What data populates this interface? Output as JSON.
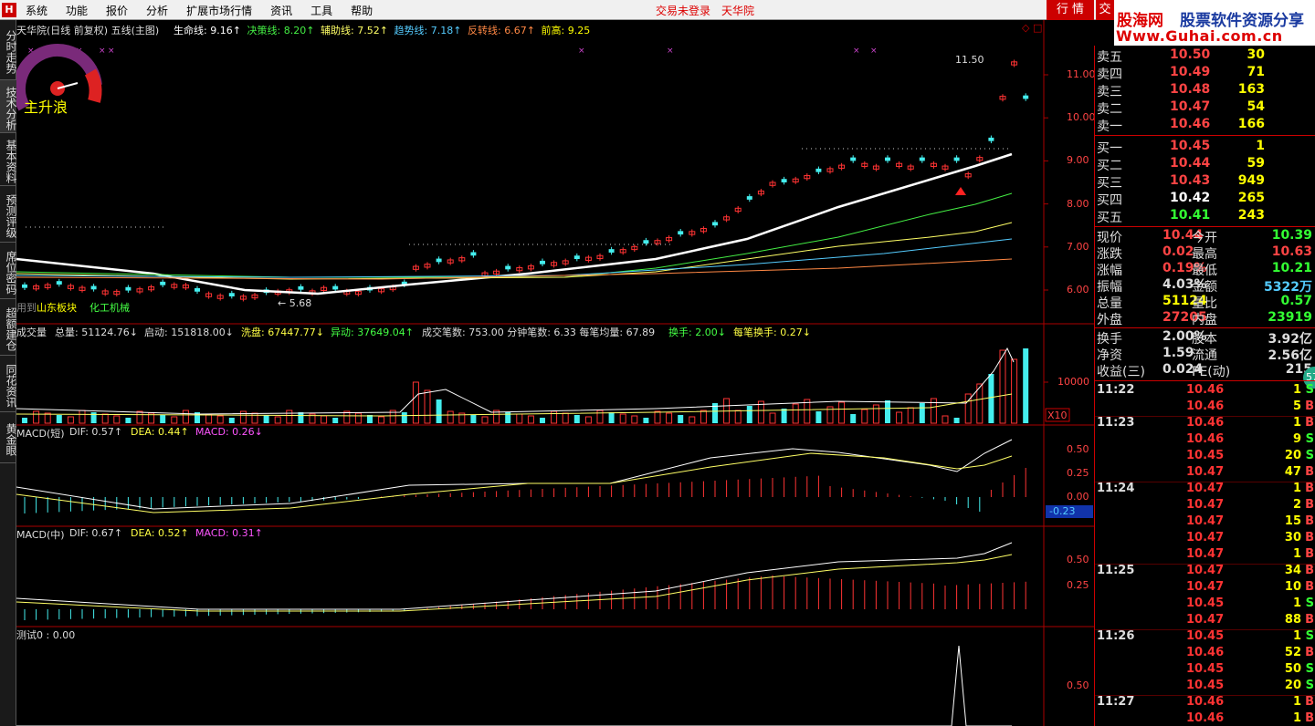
{
  "menubar": {
    "logo": "H",
    "items": [
      "系统",
      "功能",
      "报价",
      "分析",
      "扩展市场行情",
      "资讯",
      "工具",
      "帮助"
    ],
    "trade_status": "交易未登录",
    "brand": "天华院",
    "tab1": "行 情",
    "tab2": "交"
  },
  "watermark": {
    "site1": "股海网",
    "site2": "股票软件资源分享",
    "url": "Www.Guhai.com.cn"
  },
  "sidetabs": [
    "分时走势",
    "技术分析",
    "基本资料",
    "预测评级",
    "席位密码",
    "超额建仓",
    "同花资讯",
    "黄金眼"
  ],
  "gauge": {
    "label": "主升浪"
  },
  "main_legend": {
    "title": "天华院(日线 前复权) 五线(主图)",
    "items": [
      {
        "label": "生命线: 9.16",
        "color": "#ffffff"
      },
      {
        "label": "决策线: 8.20",
        "color": "#44ee44"
      },
      {
        "label": "辅助线: 7.52",
        "color": "#ffff66"
      },
      {
        "label": "趋势线: 7.18",
        "color": "#55ccff"
      },
      {
        "label": "反转线: 6.67",
        "color": "#ff8844"
      },
      {
        "label": "前高: 9.25",
        "color": "#ffff00"
      }
    ]
  },
  "price_axis": [
    "11.00",
    "10.00",
    "9.00",
    "8.00",
    "7.00",
    "6.00"
  ],
  "annotations": {
    "high": "11.50",
    "low": "5.68",
    "sector_prefix": "用到",
    "sector1": "山东板块",
    "sector2": "化工机械"
  },
  "volume_legend": {
    "title": "成交量",
    "items": [
      "总量: 51124.76↓",
      "启动: 151818.00↓",
      "洗盘: 67447.77↓",
      "异动: 37649.04↑",
      "成交笔数: 753.00 分钟笔数: 6.33 每笔均量: 67.89",
      "换手: 2.00↓",
      "每笔换手: 0.27↓"
    ],
    "axis": "10000",
    "multiplier": "X10"
  },
  "macd_short": {
    "title": "MACD(短)",
    "dif": "DIF: 0.57↑",
    "dea": "DEA: 0.44↑",
    "macd": "MACD: 0.26↓",
    "axis": [
      "0.50",
      "0.25",
      "0.00"
    ],
    "cursor": "-0.23"
  },
  "macd_mid": {
    "title": "MACD(中)",
    "dif": "DIF: 0.67↑",
    "dea": "DEA: 0.52↑",
    "macd": "MACD: 0.31↑",
    "axis": [
      "0.50",
      "0.25"
    ]
  },
  "test": {
    "title": "测试0 : 0.00",
    "axis": "0.50"
  },
  "quotes": {
    "sell": [
      {
        "label": "卖五",
        "price": "10.50",
        "vol": "30"
      },
      {
        "label": "卖四",
        "price": "10.49",
        "vol": "71"
      },
      {
        "label": "卖三",
        "price": "10.48",
        "vol": "163"
      },
      {
        "label": "卖二",
        "price": "10.47",
        "vol": "54"
      },
      {
        "label": "卖一",
        "price": "10.46",
        "vol": "166"
      }
    ],
    "buy": [
      {
        "label": "买一",
        "price": "10.45",
        "vol": "1"
      },
      {
        "label": "买二",
        "price": "10.44",
        "vol": "59"
      },
      {
        "label": "买三",
        "price": "10.43",
        "vol": "949"
      },
      {
        "label": "买四",
        "price": "10.42",
        "vol": "265"
      },
      {
        "label": "买五",
        "price": "10.41",
        "vol": "243"
      }
    ]
  },
  "stats": [
    {
      "l1": "现价",
      "v1": "10.44",
      "c1": "#ff4444",
      "l2": "今开",
      "v2": "10.39",
      "c2": "#33ff33"
    },
    {
      "l1": "涨跌",
      "v1": "0.02",
      "c1": "#ff4444",
      "l2": "最高",
      "v2": "10.63",
      "c2": "#ff4444"
    },
    {
      "l1": "涨幅",
      "v1": "0.19%",
      "c1": "#ff4444",
      "l2": "最低",
      "v2": "10.21",
      "c2": "#33ff33"
    },
    {
      "l1": "振幅",
      "v1": "4.03%",
      "c1": "#dddddd",
      "l2": "金额",
      "v2": "5322万",
      "c2": "#55ccff"
    },
    {
      "l1": "总量",
      "v1": "51124",
      "c1": "#ffff00",
      "l2": "量比",
      "v2": "0.57",
      "c2": "#33ff33"
    },
    {
      "l1": "外盘",
      "v1": "27205",
      "c1": "#ff4444",
      "l2": "内盘",
      "v2": "23919",
      "c2": "#33ff33"
    },
    {
      "l1": "换手",
      "v1": "2.00%",
      "c1": "#dddddd",
      "l2": "股本",
      "v2": "3.92亿",
      "c2": "#dddddd"
    },
    {
      "l1": "净资",
      "v1": "1.59",
      "c1": "#dddddd",
      "l2": "流通",
      "v2": "2.56亿",
      "c2": "#dddddd"
    },
    {
      "l1": "收益(三)",
      "v1": "0.024",
      "c1": "#dddddd",
      "l2": "PE(动)",
      "v2": "215",
      "c2": "#dddddd"
    }
  ],
  "badge": "57",
  "ticks": [
    {
      "t": "11:22",
      "p": "10.46",
      "v": "1",
      "f": "S"
    },
    {
      "t": "",
      "p": "10.46",
      "v": "5",
      "f": "B"
    },
    {
      "t": "11:23",
      "p": "10.46",
      "v": "1",
      "f": "B"
    },
    {
      "t": "",
      "p": "10.46",
      "v": "9",
      "f": "S"
    },
    {
      "t": "",
      "p": "10.45",
      "v": "20",
      "f": "S"
    },
    {
      "t": "",
      "p": "10.47",
      "v": "47",
      "f": "B"
    },
    {
      "t": "11:24",
      "p": "10.47",
      "v": "1",
      "f": "B"
    },
    {
      "t": "",
      "p": "10.47",
      "v": "2",
      "f": "B"
    },
    {
      "t": "",
      "p": "10.47",
      "v": "15",
      "f": "B"
    },
    {
      "t": "",
      "p": "10.47",
      "v": "30",
      "f": "B"
    },
    {
      "t": "",
      "p": "10.47",
      "v": "1",
      "f": "B"
    },
    {
      "t": "11:25",
      "p": "10.47",
      "v": "34",
      "f": "B"
    },
    {
      "t": "",
      "p": "10.47",
      "v": "10",
      "f": "B"
    },
    {
      "t": "",
      "p": "10.45",
      "v": "1",
      "f": "S"
    },
    {
      "t": "",
      "p": "10.47",
      "v": "88",
      "f": "B"
    },
    {
      "t": "11:26",
      "p": "10.45",
      "v": "1",
      "f": "S"
    },
    {
      "t": "",
      "p": "10.46",
      "v": "52",
      "f": "B"
    },
    {
      "t": "",
      "p": "10.45",
      "v": "50",
      "f": "S"
    },
    {
      "t": "",
      "p": "10.45",
      "v": "20",
      "f": "S"
    },
    {
      "t": "11:27",
      "p": "10.46",
      "v": "1",
      "f": "B"
    },
    {
      "t": "",
      "p": "10.46",
      "v": "1",
      "f": "B"
    }
  ]
}
